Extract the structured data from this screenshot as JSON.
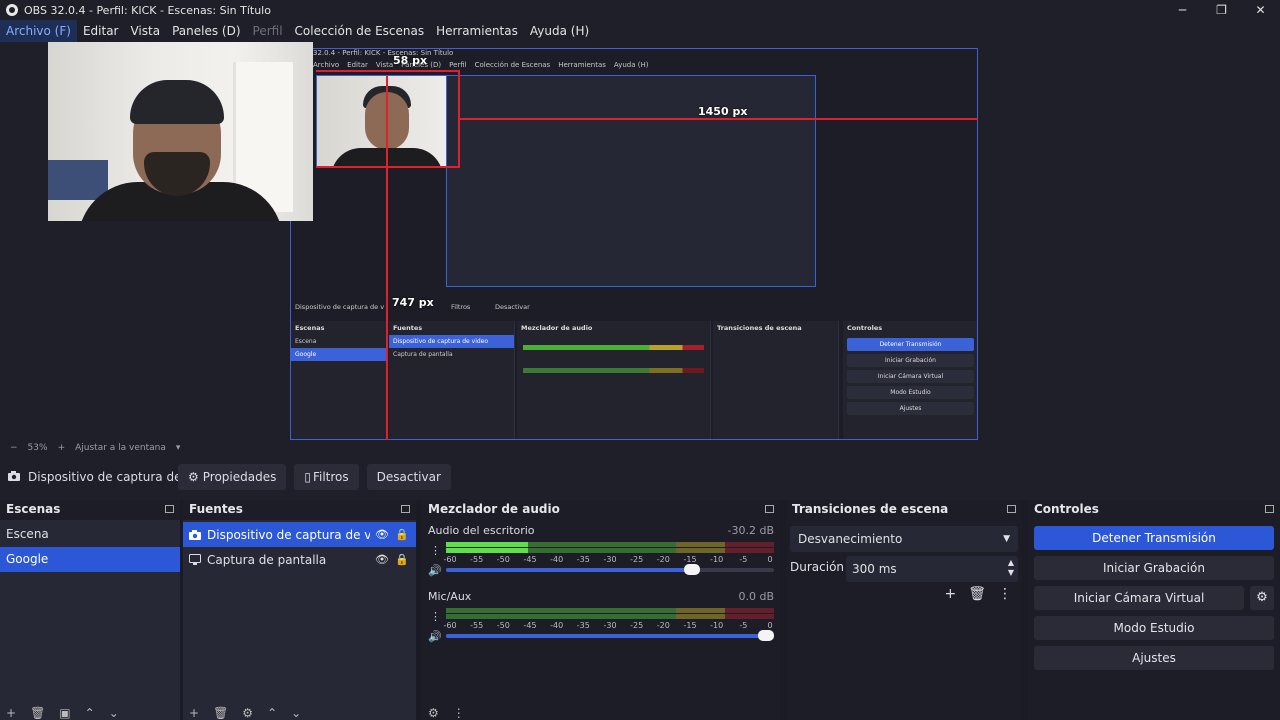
{
  "window": {
    "title": "OBS 32.0.4 - Perfil: KICK - Escenas: Sin Título",
    "controls": [
      "─",
      "❐",
      "✕"
    ]
  },
  "menu": [
    {
      "label": "Archivo (F)",
      "state": "active"
    },
    {
      "label": "Editar",
      "state": "normal"
    },
    {
      "label": "Vista",
      "state": "normal"
    },
    {
      "label": "Paneles (D)",
      "state": "normal"
    },
    {
      "label": "Perfil",
      "state": "disabled"
    },
    {
      "label": "Colección de Escenas",
      "state": "normal"
    },
    {
      "label": "Herramientas",
      "state": "normal"
    },
    {
      "label": "Ayuda (H)",
      "state": "normal"
    }
  ],
  "preview": {
    "measure_top": "58 px",
    "measure_right": "1450 px",
    "measure_bottom": "747 px",
    "nested_title": "32.0.4 - Perfil: KICK - Escenas: Sin Título",
    "nested_menu": [
      "Archivo",
      "Editar",
      "Vista",
      "Paneles (D)",
      "Perfil",
      "Colección de Escenas",
      "Herramientas",
      "Ayuda (H)"
    ],
    "nested_source": "Dispositivo de captura de v",
    "nested_filters": "Filtros",
    "nested_disable": "Desactivar",
    "nested_scenes_title": "Escenas",
    "nested_scenes": [
      "Escena",
      "Google"
    ],
    "nested_sources_title": "Fuentes",
    "nested_sources": [
      "Dispositivo de captura de video",
      "Captura de pantalla"
    ],
    "nested_mixer_title": "Mezclador de audio",
    "nested_trans_title": "Transiciones de escena",
    "nested_controls_title": "Controles",
    "nested_controls": [
      "Detener Transmisión",
      "Iniciar Grabación",
      "Iniciar Cámara Virtual",
      "Modo Estudio",
      "Ajustes"
    ]
  },
  "zoom": {
    "minus": "−",
    "value": "53%",
    "plus": "+",
    "fit": "Ajustar a la ventana",
    "arrow": "▾"
  },
  "source_bar": {
    "name": "Dispositivo de captura de v",
    "properties": "Propiedades",
    "filters": "Filtros",
    "disable": "Desactivar"
  },
  "scenes": {
    "title": "Escenas",
    "items": [
      "Escena",
      "Google"
    ],
    "selected": 1
  },
  "sources": {
    "title": "Fuentes",
    "items": [
      {
        "label": "Dispositivo de captura de video",
        "icon": "camera-icon"
      },
      {
        "label": "Captura de pantalla",
        "icon": "monitor-icon"
      }
    ]
  },
  "mixer": {
    "title": "Mezclador de audio",
    "channels": [
      {
        "name": "Audio del escritorio",
        "db": "-30.2 dB",
        "level": 0.5,
        "volume": 0.75
      },
      {
        "name": "Mic/Aux",
        "db": "0.0 dB",
        "level": 0,
        "volume": 1.0
      }
    ],
    "ticks": [
      "-60",
      "-55",
      "-50",
      "-45",
      "-40",
      "-35",
      "-30",
      "-25",
      "-20",
      "-15",
      "-10",
      "-5",
      "0"
    ]
  },
  "transitions": {
    "title": "Transiciones de escena",
    "selected": "Desvanecimiento",
    "duration_label": "Duración",
    "duration_value": "300 ms"
  },
  "controls": {
    "title": "Controles",
    "stream": "Detener Transmisión",
    "record": "Iniciar Grabación",
    "virtual_cam": "Iniciar Cámara Virtual",
    "studio": "Modo Estudio",
    "settings": "Ajustes"
  },
  "colors": {
    "accent": "#2c58d8",
    "meter_green": "#4caf3a",
    "meter_yellow": "#b7a12c",
    "meter_red": "#a3202f",
    "measure_red": "#e0202a"
  }
}
